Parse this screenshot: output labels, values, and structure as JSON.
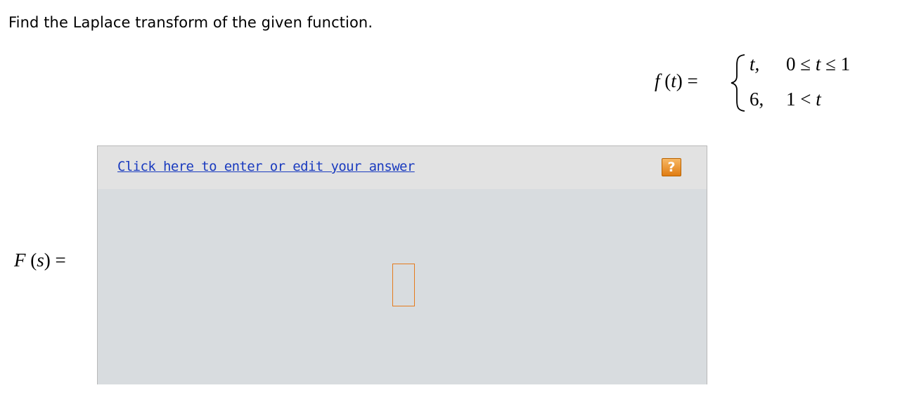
{
  "question": {
    "text": "Find the Laplace transform of the given function."
  },
  "function_def": {
    "lhs_f": "f",
    "lhs_arg": "(t) =",
    "brace": "{",
    "cases": [
      {
        "value": "t,",
        "value_italic": true,
        "condition_parts": [
          "0 ≤ ",
          "t",
          " ≤ 1"
        ]
      },
      {
        "value": "6,",
        "value_italic": false,
        "condition_parts": [
          "1 < ",
          "t",
          ""
        ]
      }
    ]
  },
  "answer": {
    "lhs_F": "F",
    "lhs_arg_open": " (",
    "lhs_var": "s",
    "lhs_arg_close": ") =",
    "edit_link_text": "Click here to enter or edit your answer",
    "help_icon_glyph": "?",
    "colors": {
      "header_bg": "#e2e2e2",
      "body_bg": "#d8dcdf",
      "link": "#1a3bbf",
      "help_button": "#f0992f",
      "slot_border": "#e57b1d"
    }
  }
}
